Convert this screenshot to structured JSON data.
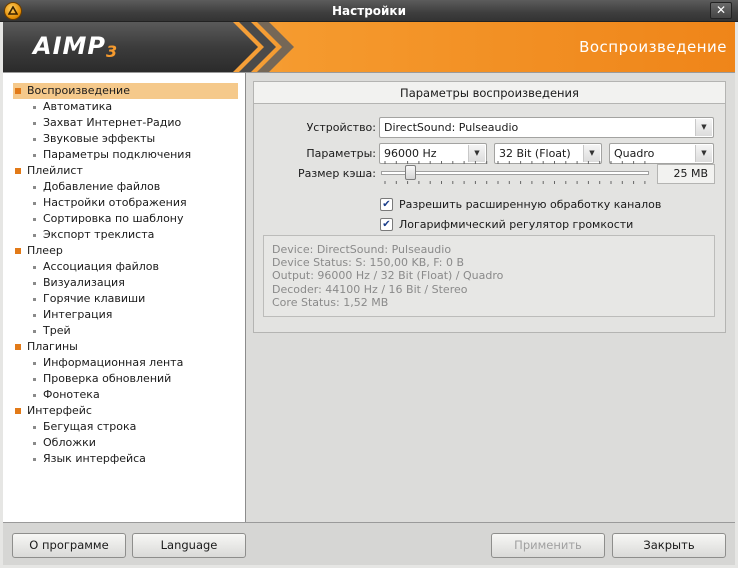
{
  "window": {
    "title": "Настройки",
    "app_icon": "aimp-logo-icon",
    "close_label": "✕"
  },
  "banner": {
    "logo_text": "AIMP",
    "logo_version": "3",
    "section_title": "Воспроизведение"
  },
  "sidebar": {
    "groups": [
      {
        "label": "Воспроизведение",
        "selected": true,
        "items": [
          "Автоматика",
          "Захват Интернет-Радио",
          "Звуковые эффекты",
          "Параметры подключения"
        ]
      },
      {
        "label": "Плейлист",
        "items": [
          "Добавление файлов",
          "Настройки отображения",
          "Сортировка по шаблону",
          "Экспорт треклиста"
        ]
      },
      {
        "label": "Плеер",
        "items": [
          "Ассоциация файлов",
          "Визуализация",
          "Горячие клавиши",
          "Интеграция",
          "Трей"
        ]
      },
      {
        "label": "Плагины",
        "items": [
          "Информационная лента",
          "Проверка обновлений",
          "Фонотека"
        ]
      },
      {
        "label": "Интерфейс",
        "items": [
          "Бегущая строка",
          "Обложки",
          "Язык интерфейса"
        ]
      }
    ]
  },
  "panel": {
    "header": "Параметры воспроизведения",
    "device": {
      "label": "Устройство:",
      "value": "DirectSound: Pulseaudio"
    },
    "params": {
      "label": "Параметры:",
      "rate": "96000 Hz",
      "bits": "32 Bit (Float)",
      "channels": "Quadro"
    },
    "cache": {
      "label": "Размер кэша:",
      "value": "25 MB",
      "slider_fraction": 0.11
    },
    "checkboxes": [
      {
        "label": "Разрешить расширенную обработку каналов",
        "checked": true
      },
      {
        "label": "Логарифмический регулятор громкости",
        "checked": true
      }
    ],
    "status_lines": [
      "Device: DirectSound: Pulseaudio",
      "Device Status: S: 150,00 KB, F: 0 B",
      "Output: 96000 Hz / 32 Bit (Float) / Quadro",
      "Decoder: 44100 Hz / 16 Bit / Stereo",
      "Core Status: 1,52 MB"
    ]
  },
  "buttons": {
    "about": "О программе",
    "language": "Language",
    "apply": "Применить",
    "close": "Закрыть"
  },
  "colors": {
    "accent": "#f08a1e",
    "selection": "#f5c98b",
    "banner_dark": "#3a3a3a"
  }
}
